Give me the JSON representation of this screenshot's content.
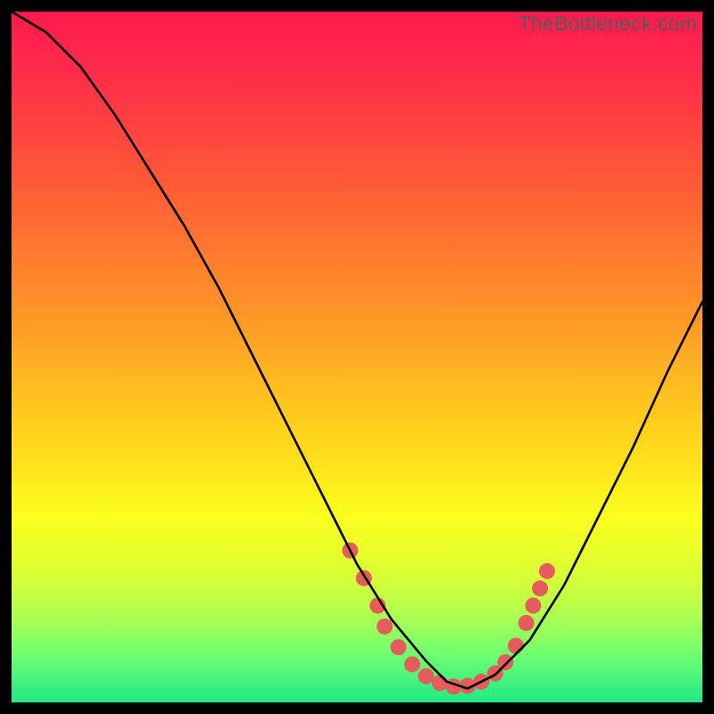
{
  "watermark": "TheBottleneck.com",
  "chart_data": {
    "type": "line",
    "title": "",
    "xlabel": "",
    "ylabel": "",
    "xlim": [
      0,
      100
    ],
    "ylim": [
      0,
      100
    ],
    "grid": false,
    "series": [
      {
        "name": "bottleneck-curve",
        "x": [
          0,
          5,
          10,
          15,
          20,
          25,
          30,
          35,
          40,
          45,
          50,
          55,
          60,
          63,
          66,
          70,
          75,
          80,
          85,
          90,
          95,
          100
        ],
        "values": [
          100,
          97,
          92,
          85,
          77,
          69,
          60,
          50,
          40,
          30,
          20,
          12,
          6,
          3,
          2,
          4,
          9,
          17,
          27,
          37,
          48,
          58
        ]
      }
    ],
    "markers": {
      "name": "highlighted-points",
      "color": "#e65b5b",
      "radius": 9,
      "points": [
        {
          "x": 49,
          "y": 22
        },
        {
          "x": 51,
          "y": 18
        },
        {
          "x": 53,
          "y": 14
        },
        {
          "x": 54,
          "y": 11
        },
        {
          "x": 56,
          "y": 8
        },
        {
          "x": 58,
          "y": 5.5
        },
        {
          "x": 60,
          "y": 3.8
        },
        {
          "x": 62,
          "y": 2.8
        },
        {
          "x": 64,
          "y": 2.3
        },
        {
          "x": 66,
          "y": 2.4
        },
        {
          "x": 68,
          "y": 3.0
        },
        {
          "x": 70,
          "y": 4.2
        },
        {
          "x": 71.5,
          "y": 5.8
        },
        {
          "x": 73,
          "y": 8.2
        },
        {
          "x": 74.5,
          "y": 11.5
        },
        {
          "x": 75.5,
          "y": 14
        },
        {
          "x": 76.5,
          "y": 16.5
        },
        {
          "x": 77.5,
          "y": 19
        }
      ]
    }
  }
}
